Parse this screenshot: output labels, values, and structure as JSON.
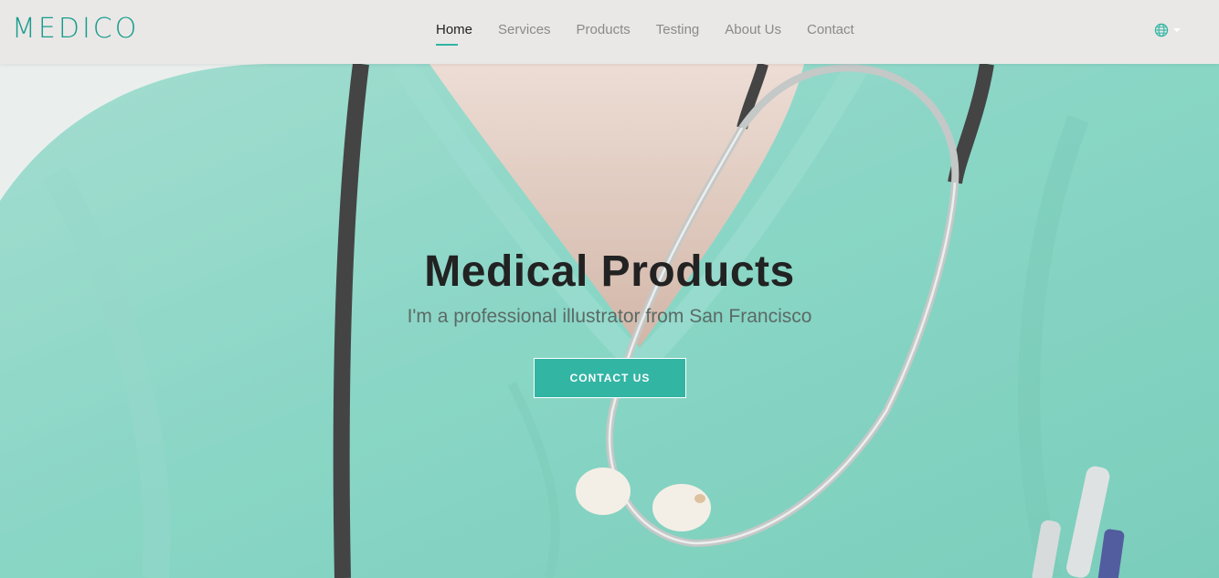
{
  "brand": {
    "logo": "MEDICO",
    "accent_color": "#1a9c8e",
    "button_color": "#33b5a4"
  },
  "nav": {
    "items": [
      {
        "label": "Home",
        "active": true
      },
      {
        "label": "Services",
        "active": false
      },
      {
        "label": "Products",
        "active": false
      },
      {
        "label": "Testing",
        "active": false
      },
      {
        "label": "About Us",
        "active": false
      },
      {
        "label": "Contact",
        "active": false
      }
    ],
    "language_icon": "globe-icon"
  },
  "hero": {
    "title": "Medical Products",
    "subtitle": "I'm a professional illustrator from San Francisco",
    "cta_label": "CONTACT US",
    "background": "doctor-in-green-scrubs-with-stethoscope"
  }
}
